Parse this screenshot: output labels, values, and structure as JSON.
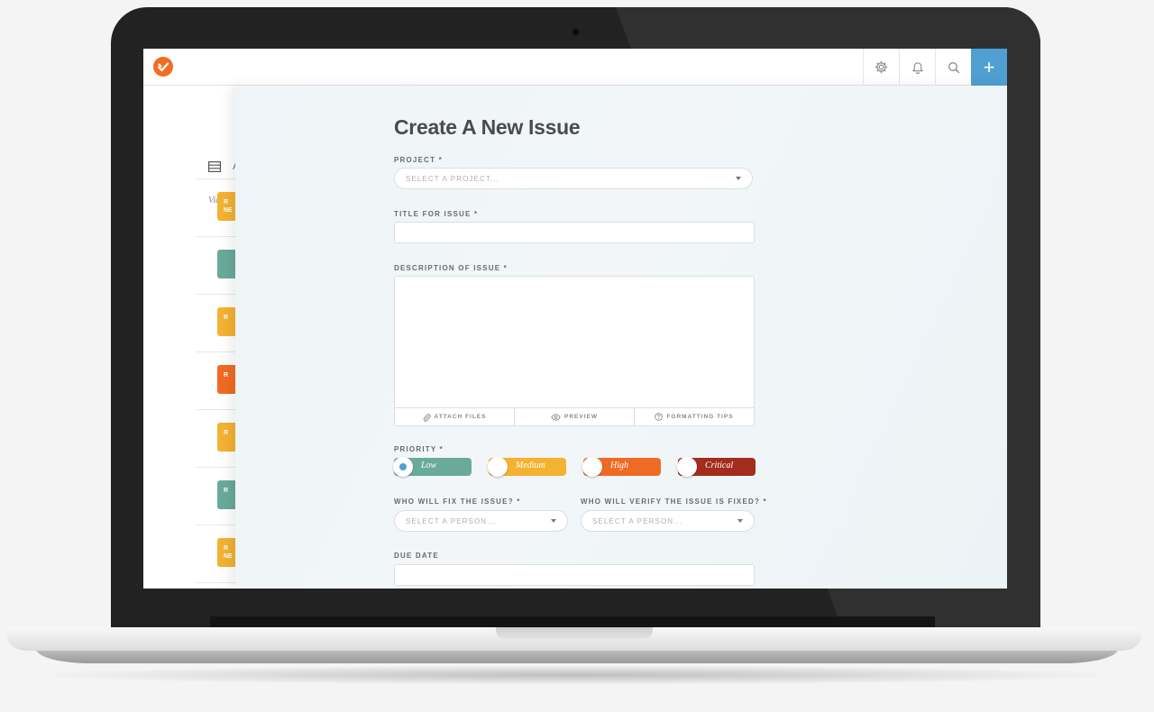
{
  "form": {
    "title": "Create A New Issue",
    "project_label": "PROJECT *",
    "project_placeholder": "SELECT A PROJECT...",
    "title_label": "TITLE FOR ISSUE *",
    "description_label": "DESCRIPTION OF ISSUE *",
    "tools": {
      "attach": "ATTACH FILES",
      "preview": "PREVIEW",
      "formatting": "FORMATTING TIPS"
    },
    "priority_label": "PRIORITY *",
    "priorities": [
      {
        "label": "Low",
        "color": "#6aaa9b",
        "selected": true
      },
      {
        "label": "Medium",
        "color": "#f3b232",
        "selected": false
      },
      {
        "label": "High",
        "color": "#ef6b24",
        "selected": false
      },
      {
        "label": "Critical",
        "color": "#a32c1c",
        "selected": false
      }
    ],
    "fixer_label": "WHO WILL FIX THE ISSUE? *",
    "fixer_placeholder": "SELECT A PERSON...",
    "verifier_label": "WHO WILL VERIFY THE ISSUE IS FIXED? *",
    "verifier_placeholder": "SELECT A PERSON...",
    "due_label": "DUE DATE"
  },
  "background": {
    "list_partial": "A",
    "viewing_partial": "Viewin",
    "tags": [
      {
        "text": "R NE",
        "color": "#f3b232"
      },
      {
        "text": "",
        "color": "#6aaa9b"
      },
      {
        "text": "R",
        "color": "#f3b232"
      },
      {
        "text": "R",
        "color": "#ef6b24"
      },
      {
        "text": "R",
        "color": "#f3b232"
      },
      {
        "text": "R",
        "color": "#6aaa9b"
      },
      {
        "text": "R NE",
        "color": "#f3b232"
      }
    ]
  },
  "topbar": {
    "icons": [
      "settings-icon",
      "bell-icon",
      "search-icon",
      "plus-icon"
    ],
    "plus_label": "+",
    "accent": "#4f9fd3",
    "logo_color": "#f26d21"
  }
}
